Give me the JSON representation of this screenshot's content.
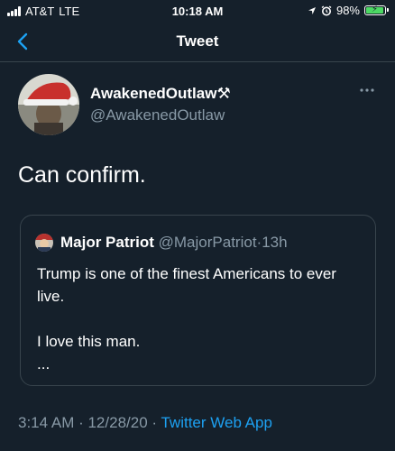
{
  "status_bar": {
    "carrier": "AT&T",
    "network": "LTE",
    "time": "10:18 AM",
    "battery_percent": "98%",
    "battery_level": 0.98,
    "icons": [
      "signal-icon",
      "location-arrow-icon",
      "alarm-icon",
      "battery-charging-icon"
    ]
  },
  "nav": {
    "title": "Tweet",
    "back_icon": "chevron-left-icon"
  },
  "tweet": {
    "display_name": "AwakenedOutlaw",
    "name_emoji": "⚒",
    "username": "@AwakenedOutlaw",
    "text": "Can confirm.",
    "timestamp": "3:14 AM · 12/28/20",
    "separator": " · ",
    "source": "Twitter Web App",
    "more_icon": "more-horizontal-icon"
  },
  "quoted_tweet": {
    "display_name": "Major Patriot",
    "username": "@MajorPatriot",
    "separator": "·",
    "age": "13h",
    "line1": "Trump is one of the finest Americans to ever live.",
    "line2": "I love this man.",
    "ellipsis": "..."
  },
  "colors": {
    "background": "#15202b",
    "secondary_text": "#8899a6",
    "accent": "#1da1f2",
    "border": "#38444d"
  }
}
